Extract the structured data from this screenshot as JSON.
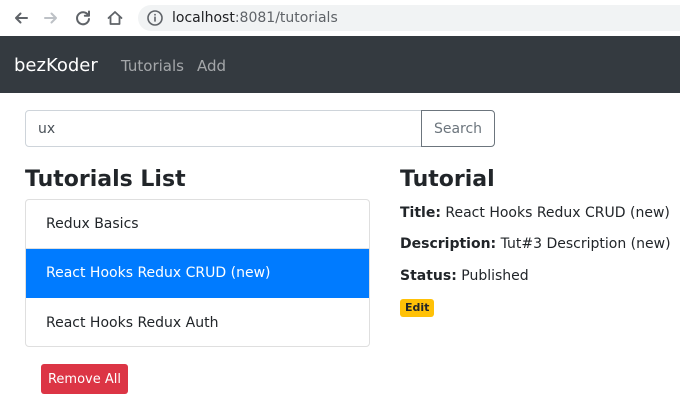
{
  "browser": {
    "url_host": "localhost",
    "url_rest": ":8081/tutorials"
  },
  "navbar": {
    "brand": "bezKoder",
    "links": [
      "Tutorials",
      "Add"
    ]
  },
  "search": {
    "value": "ux",
    "button_label": "Search"
  },
  "list": {
    "heading": "Tutorials List",
    "items": [
      "Redux Basics",
      "React Hooks Redux CRUD (new)",
      "React Hooks Redux Auth"
    ],
    "active_index": 1,
    "remove_all_label": "Remove All"
  },
  "detail": {
    "heading": "Tutorial",
    "title_label": "Title:",
    "title_value": "React Hooks Redux CRUD (new)",
    "description_label": "Description:",
    "description_value": "Tut#3 Description (new)",
    "status_label": "Status:",
    "status_value": "Published",
    "edit_label": "Edit"
  },
  "colors": {
    "navbar_bg": "#343a40",
    "active_item": "#007bff",
    "danger": "#dc3545",
    "warning": "#ffc107"
  },
  "icons": {
    "back": "arrow-left-icon",
    "forward": "arrow-right-icon",
    "reload": "reload-icon",
    "home": "home-icon",
    "site_info": "info-icon"
  }
}
